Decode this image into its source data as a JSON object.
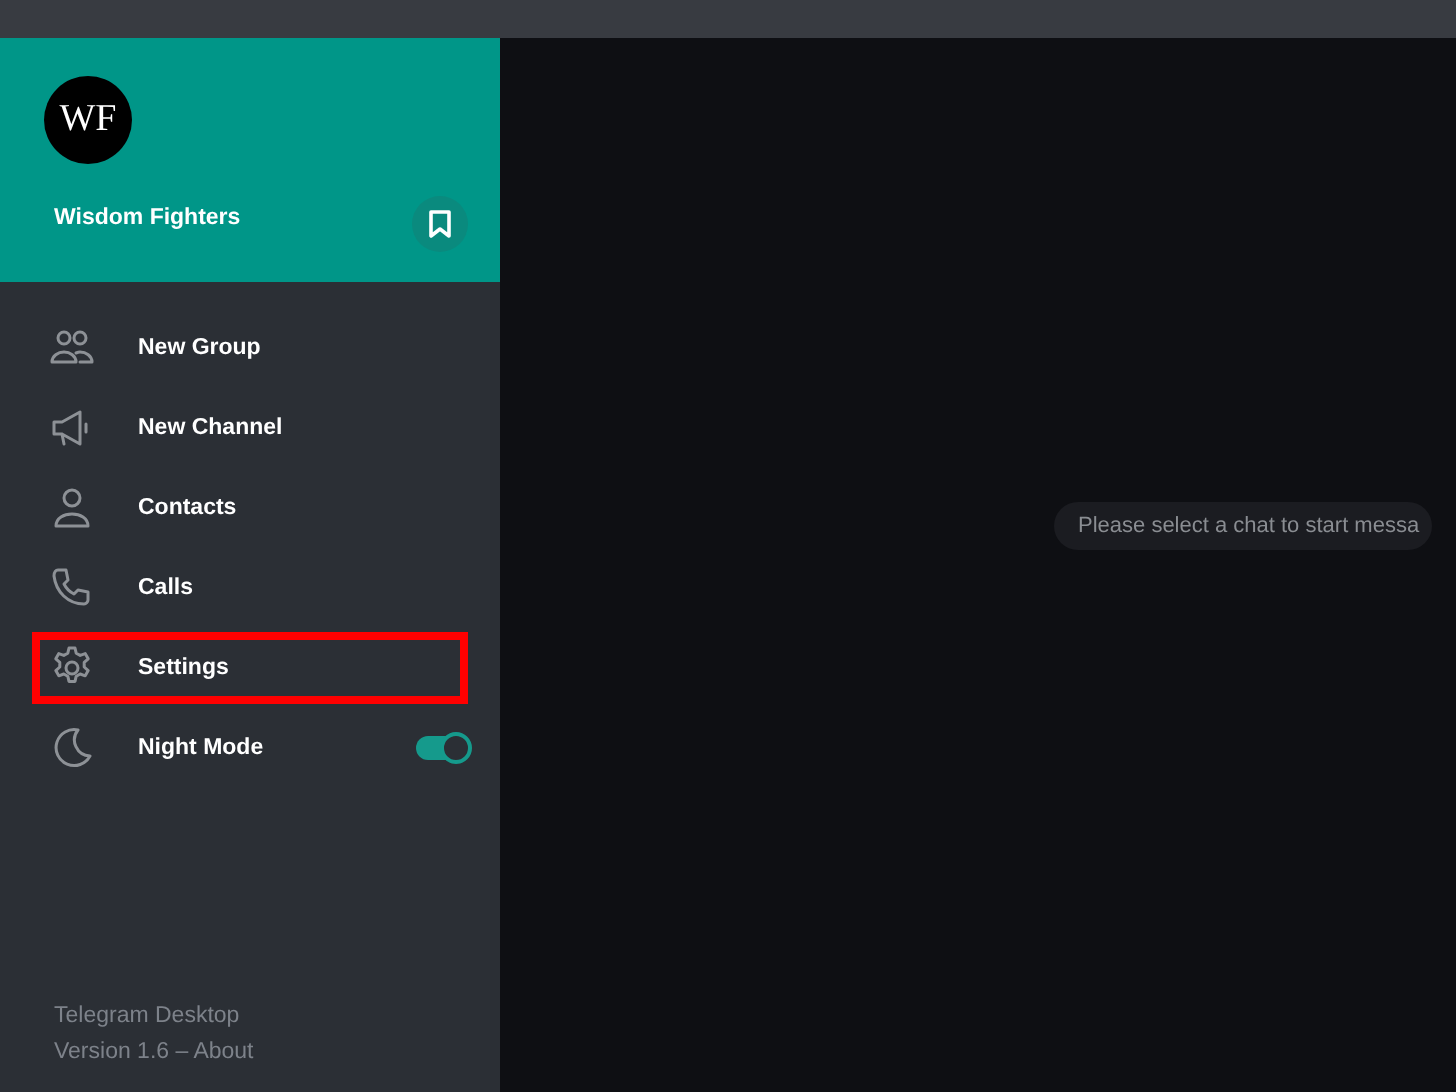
{
  "profile": {
    "initials": "WF",
    "name": "Wisdom Fighters"
  },
  "menu": [
    {
      "kind": "item",
      "label": "New Group",
      "highlighted": false
    },
    {
      "kind": "item",
      "label": "New Channel",
      "highlighted": false
    },
    {
      "kind": "item",
      "label": "Contacts",
      "highlighted": false
    },
    {
      "kind": "item",
      "label": "Calls",
      "highlighted": false
    },
    {
      "kind": "item",
      "label": "Settings",
      "highlighted": true
    },
    {
      "kind": "toggle",
      "label": "Night Mode",
      "highlighted": false,
      "on": true
    }
  ],
  "footer": {
    "app_name": "Telegram Desktop",
    "version": "Version 1.6 – About"
  },
  "main": {
    "placeholder_message": "Please select a chat to start messa"
  }
}
